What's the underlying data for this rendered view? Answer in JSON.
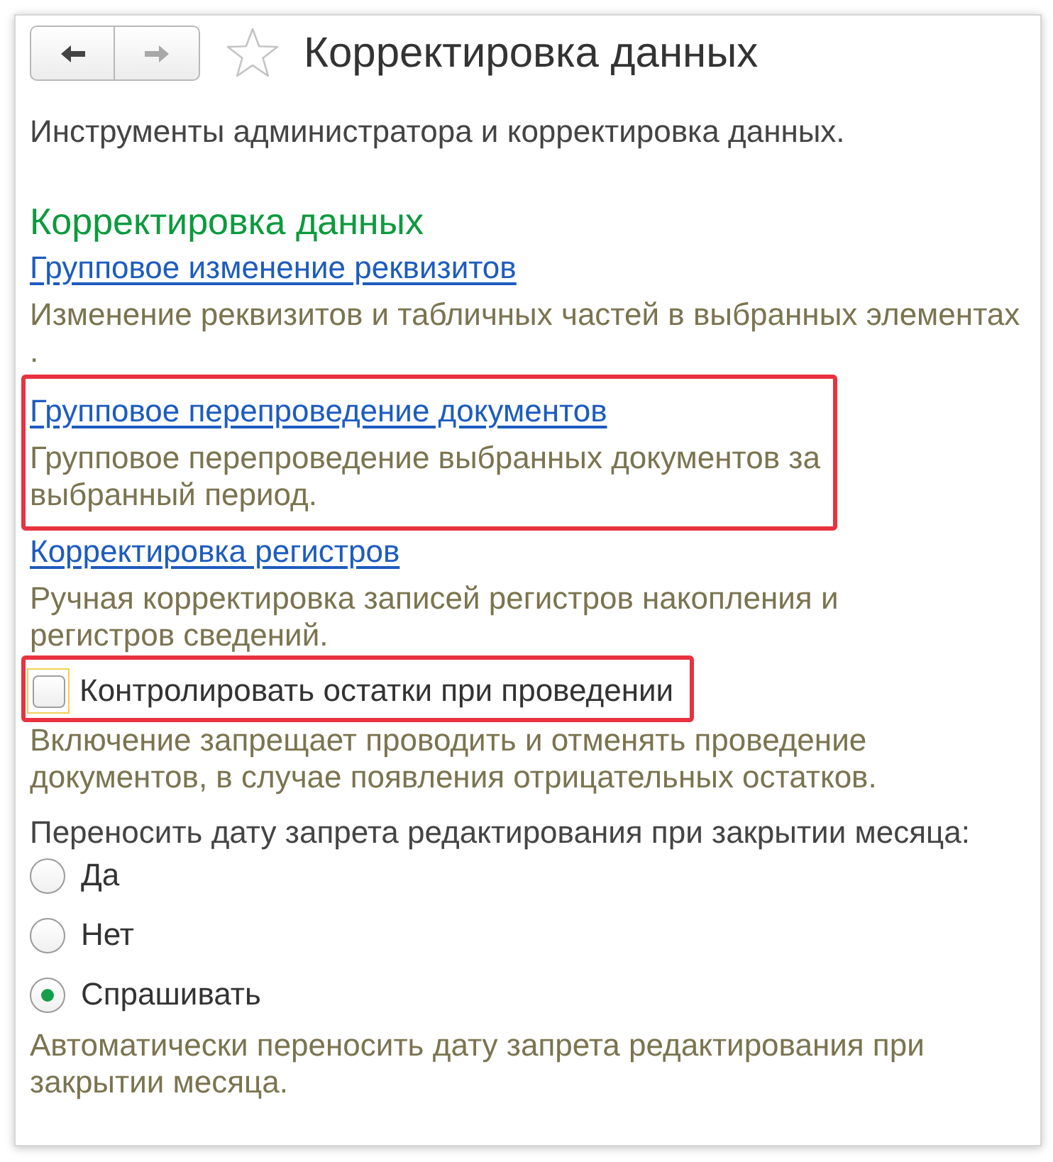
{
  "window": {
    "title": "Корректировка данных",
    "favorite": false
  },
  "nav_buttons": [
    {
      "kind": "back",
      "disabled": false
    },
    {
      "kind": "forward",
      "disabled": true
    }
  ],
  "intro": "Инструменты администратора и корректировка данных.",
  "section": {
    "title": "Корректировка данных",
    "items": [
      {
        "kind": "link",
        "label": "Групповое изменение реквизитов",
        "description": "Изменение реквизитов и табличных частей в выбранных элементах\n.",
        "highlighted": false
      },
      {
        "kind": "link",
        "label": "Групповое перепроведение документов",
        "description": "Групповое перепроведение выбранных документов за\nвыбранный период.",
        "highlighted": true
      },
      {
        "kind": "link",
        "label": "Корректировка регистров",
        "description": "Ручная корректировка записей регистров накопления и\nрегистров сведений.",
        "highlighted": false
      },
      {
        "kind": "checkbox",
        "label": "Контролировать остатки при проведении",
        "checked": false,
        "focused": true,
        "highlighted": true,
        "description": "Включение запрещает проводить и отменять проведение\nдокументов, в случае появления отрицательных остатков."
      },
      {
        "kind": "radio_group",
        "label": "Переносить дату запрета редактирования при закрытии месяца:",
        "options": [
          {
            "label": "Да",
            "selected": false
          },
          {
            "label": "Нет",
            "selected": false
          },
          {
            "label": "Спрашивать",
            "selected": true
          }
        ],
        "description": "Автоматически переносить дату запрета редактирования при\nзакрытии месяца."
      }
    ]
  }
}
